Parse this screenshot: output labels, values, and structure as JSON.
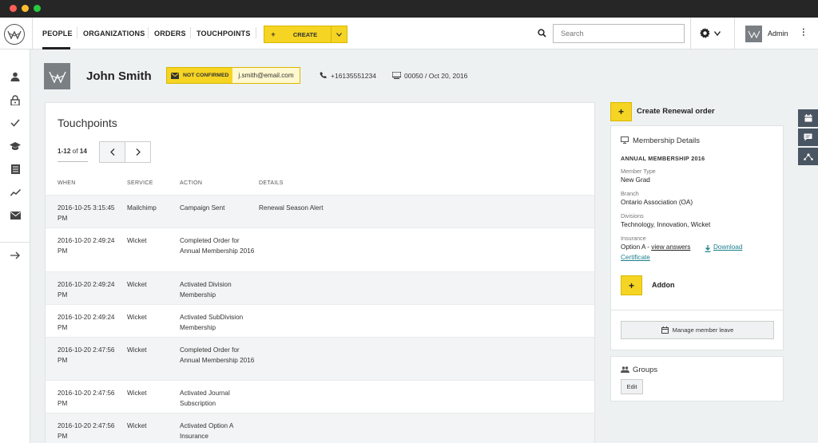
{
  "nav": {
    "items": [
      "PEOPLE",
      "ORGANIZATIONS",
      "ORDERS",
      "TOUCHPOINTS"
    ],
    "create_plus": "+",
    "create_label": "CREATE",
    "search_placeholder": "Search",
    "admin_name": "Admin"
  },
  "profile": {
    "name": "John Smith",
    "status_badge": "NOT CONFIRMED",
    "email": "j.smith@email.com",
    "phone": "+16135551234",
    "member_info": "00050 / Oct 20, 2016"
  },
  "touchpoints": {
    "title": "Touchpoints",
    "pagination_range": "1-12",
    "pagination_of": "of",
    "pagination_total": "14",
    "columns": [
      "WHEN",
      "SERVICE",
      "ACTION",
      "DETAILS"
    ],
    "rows": [
      {
        "when": "2016-10-25 3:15:45 PM",
        "service": "Mailchimp",
        "action": "Campaign Sent",
        "details": "Renewal Season Alert"
      },
      {
        "when": "2016-10-20 2:49:24 PM",
        "service": "Wicket",
        "action": "Completed Order for Annual Membership 2016",
        "details": ""
      },
      {
        "when": "2016-10-20 2:49:24 PM",
        "service": "Wicket",
        "action": "Activated Division Membership",
        "details": ""
      },
      {
        "when": "2016-10-20 2:49:24 PM",
        "service": "Wicket",
        "action": "Activated SubDivision Membership",
        "details": ""
      },
      {
        "when": "2016-10-20 2:47:56 PM",
        "service": "Wicket",
        "action": "Completed Order for Annual Membership 2016",
        "details": ""
      },
      {
        "when": "2016-10-20 2:47:56 PM",
        "service": "Wicket",
        "action": "Activated Journal Subscription",
        "details": ""
      },
      {
        "when": "2016-10-20 2:47:56 PM",
        "service": "Wicket",
        "action": "Activated Option A Insurance",
        "details": ""
      }
    ]
  },
  "renewal": {
    "plus": "+",
    "label": "Create Renewal order"
  },
  "membership": {
    "title": "Membership Details",
    "name": "ANNUAL MEMBERSHIP 2016",
    "member_type_label": "Member Type",
    "member_type": "New Grad",
    "branch_label": "Branch",
    "branch": "Ontario Association (OA)",
    "divisions_label": "Divisions",
    "divisions": "Technology, Innovation, Wicket",
    "insurance_label": "Insurance",
    "insurance_value": "Option A - ",
    "view_answers": "view answers",
    "download": "Download",
    "certificate": "Certificate",
    "addon_plus": "+",
    "addon_label": "Addon",
    "leave_button": "Manage member leave"
  },
  "groups": {
    "title": "Groups",
    "edit_label": "Edit"
  },
  "colors": {
    "accent": "#f5d423",
    "dark": "#262626",
    "link": "#1b7f8c",
    "side_tab": "#4a5563"
  },
  "icons": [
    "logo-icon",
    "person-icon",
    "lock-icon",
    "check-icon",
    "graduation-cap-icon",
    "list-icon",
    "trend-icon",
    "mail-icon",
    "arrow-right-icon",
    "search-icon",
    "gear-icon",
    "chevron-down-icon",
    "phone-icon",
    "card-icon",
    "envelope-icon",
    "monitor-icon",
    "download-icon",
    "calendar-icon",
    "people-icon",
    "chat-icon",
    "network-icon"
  ]
}
